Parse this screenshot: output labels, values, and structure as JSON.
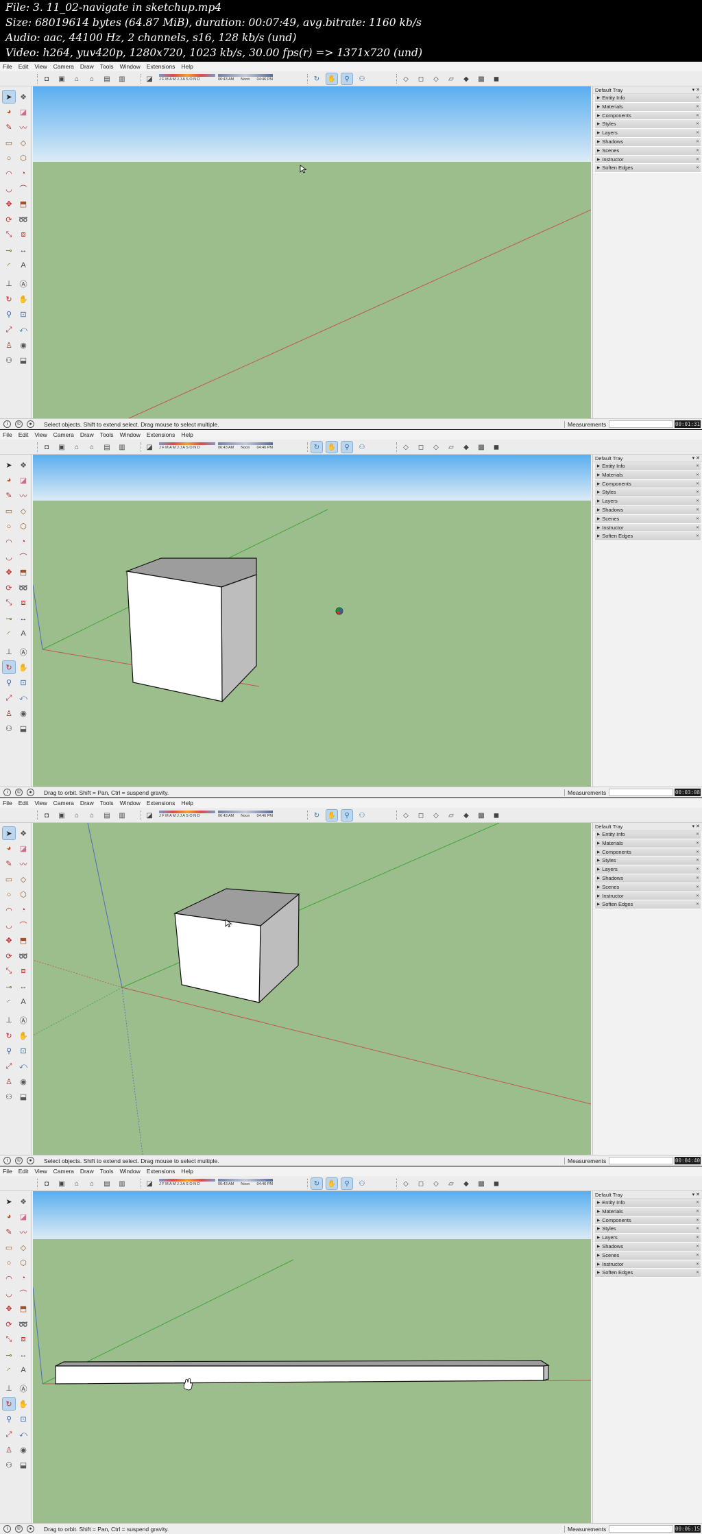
{
  "file_info": {
    "file": "File: 3. 11_02-navigate in sketchup.mp4",
    "size": "Size: 68019614 bytes (64.87 MiB), duration: 00:07:49, avg.bitrate: 1160 kb/s",
    "audio": "Audio: aac, 44100 Hz, 2 channels, s16, 128 kb/s (und)",
    "video": "Video: h264, yuv420p, 1280x720, 1023 kb/s, 30.00 fps(r) => 1371x720 (und)"
  },
  "menu": [
    "File",
    "Edit",
    "View",
    "Camera",
    "Draw",
    "Tools",
    "Window",
    "Extensions",
    "Help"
  ],
  "shadow_slider": {
    "months": "J F M A M J J A S O N D"
  },
  "time_slider": {
    "start": "06:43 AM",
    "noon": "Noon",
    "end": "04:46 PM"
  },
  "toolbar_icons": [
    "camera-icon",
    "box-icon",
    "home-icon",
    "house-icon",
    "warehouse-icon",
    "storefront-icon",
    "eraser-icon",
    "orbit-icon",
    "pan-icon",
    "zoom-icon",
    "walk-icon",
    "xray-icon",
    "back-edges-icon",
    "wireframe-icon",
    "hidden-line-icon",
    "shaded-icon",
    "shaded-textures-icon",
    "monochrome-icon"
  ],
  "tool_icons": [
    "select-arrow-icon",
    "make-component-icon",
    "paint-bucket-icon",
    "eraser-icon",
    "pencil-icon",
    "freehand-icon",
    "rectangle-icon",
    "rotated-rectangle-icon",
    "circle-icon",
    "polygon-icon",
    "arc-icon",
    "pie-icon",
    "two-point-arc-icon",
    "three-point-arc-icon",
    "move-icon",
    "push-pull-icon",
    "rotate-icon",
    "follow-me-icon",
    "scale-icon",
    "offset-icon",
    "tape-measure-icon",
    "dimension-icon",
    "protractor-icon",
    "text-icon",
    "axes-icon",
    "3d-text-icon",
    "orbit-icon",
    "pan-icon",
    "zoom-icon",
    "zoom-window-icon",
    "zoom-extents-icon",
    "previous-view-icon",
    "position-camera-icon",
    "look-around-icon",
    "walk-icon",
    "section-plane-icon"
  ],
  "tray": {
    "title": "Default Tray",
    "controls": "▾ ✕",
    "items": [
      "Entity Info",
      "Materials",
      "Components",
      "Styles",
      "Layers",
      "Shadows",
      "Scenes",
      "Instructor",
      "Soften Edges"
    ],
    "item_close": "✕"
  },
  "measurements_label": "Measurements",
  "frames": [
    {
      "status": "Select objects. Shift to extend select. Drag mouse to select multiple.",
      "timestamp": "00:01:31",
      "active_tool": "select",
      "active_toolbar": "none"
    },
    {
      "status": "Drag to orbit. Shift = Pan, Ctrl = suspend gravity.",
      "timestamp": "00:03:08",
      "active_tool": "orbit",
      "active_toolbar": "orbit"
    },
    {
      "status": "Select objects. Shift to extend select. Drag mouse to select multiple.",
      "timestamp": "00:04:40",
      "active_tool": "select",
      "active_toolbar": "none"
    },
    {
      "status": "Drag to orbit. Shift = Pan, Ctrl = suspend gravity.",
      "timestamp": "00:06:15",
      "active_tool": "orbit",
      "active_toolbar": "orbit"
    }
  ],
  "colors": {
    "sky_top": "#5aaeef",
    "sky_bottom": "#dcebf6",
    "ground": "#9cbd8c",
    "red_axis": "#c0584f",
    "green_axis": "#3fa63f",
    "blue_axis": "#4a6fb8",
    "box_front": "#ffffff",
    "box_side": "#bdbdbd",
    "box_top": "#9d9d9d",
    "highlight": "#bcd6ee"
  }
}
